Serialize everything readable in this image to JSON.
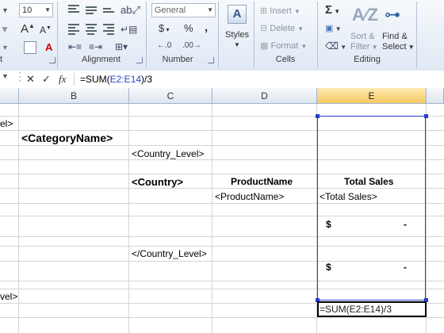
{
  "ribbon": {
    "font_size_value": "10",
    "alignment_label": "Alignment",
    "number_label": "Number",
    "number_format": "General",
    "currency_symbol": "$",
    "percent_symbol": "%",
    "comma_symbol": ",",
    "styles_label": "Styles",
    "cells_label": "Cells",
    "insert_label": "Insert",
    "delete_label": "Delete",
    "format_label": "Format",
    "editing_label": "Editing",
    "sum_symbol": "Σ",
    "sort_label_1": "Sort &",
    "sort_label_2": "Filter",
    "find_label_1": "Find &",
    "find_label_2": "Select",
    "font_group_partial": "t",
    "grow_font": "A",
    "shrink_font": "A"
  },
  "formula_bar": {
    "cancel_symbol": "✕",
    "enter_symbol": "✓",
    "fx_symbol": "fx",
    "formula_prefix": "=SUM(",
    "formula_ref": "E2:E14",
    "formula_suffix": ")/3"
  },
  "columns": [
    "B",
    "C",
    "D",
    "E"
  ],
  "cells": {
    "a_partial_1": "el>",
    "category_name": "<CategoryName>",
    "country_level_open": "<Country_Level>",
    "country": "<Country>",
    "product_name_header": "ProductName",
    "total_sales_header": "Total Sales",
    "product_name_tag": "<ProductName>",
    "total_sales_tag": "<Total Sales>",
    "dollar_1": "$",
    "dash_1": "-",
    "country_level_close": "</Country_Level>",
    "dollar_2": "$",
    "dash_2": "-",
    "a_partial_2": "vel>",
    "edit_formula": "=SUM(E2:E14)/3"
  },
  "colors": {
    "selection_border": "#2a3cd0",
    "active_column_header": "#f6c964",
    "ribbon_bg": "#dfe8f4"
  }
}
